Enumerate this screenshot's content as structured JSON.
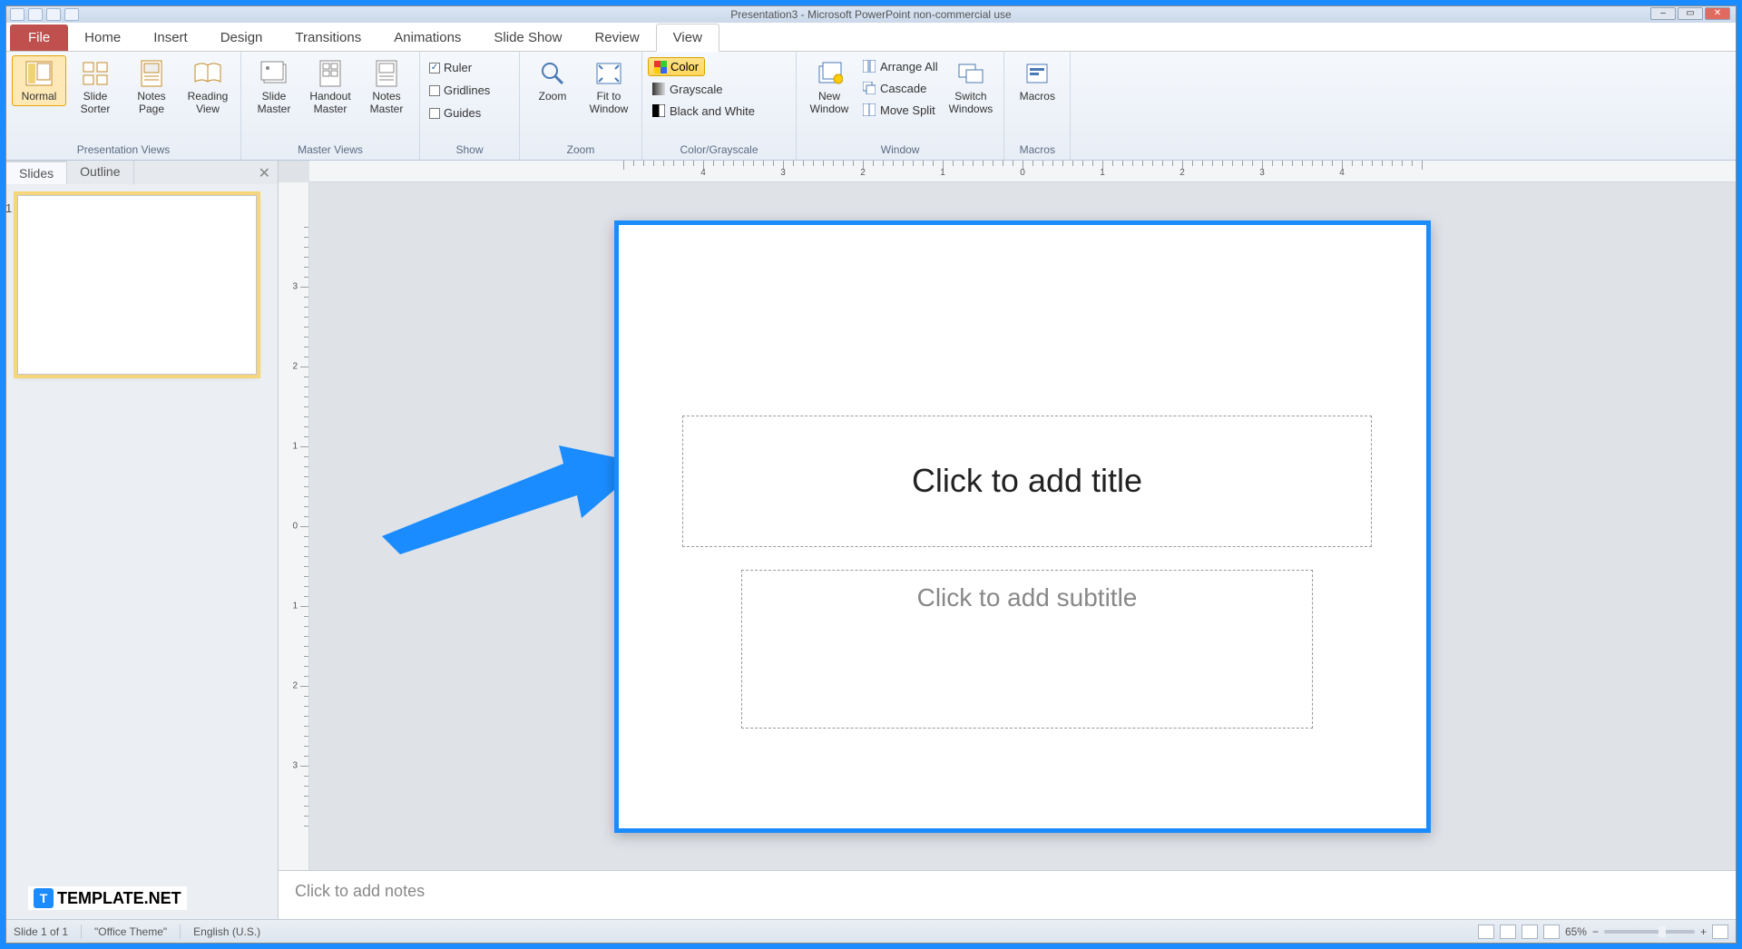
{
  "titlebar": {
    "title": "Presentation3 - Microsoft PowerPoint non-commercial use"
  },
  "tabs": {
    "file": "File",
    "items": [
      "Home",
      "Insert",
      "Design",
      "Transitions",
      "Animations",
      "Slide Show",
      "Review",
      "View"
    ],
    "active": "View"
  },
  "ribbon": {
    "presentation_views": {
      "title": "Presentation Views",
      "normal": "Normal",
      "slide_sorter": "Slide\nSorter",
      "notes_page": "Notes\nPage",
      "reading_view": "Reading\nView"
    },
    "master_views": {
      "title": "Master Views",
      "slide_master": "Slide\nMaster",
      "handout_master": "Handout\nMaster",
      "notes_master": "Notes\nMaster"
    },
    "show": {
      "title": "Show",
      "ruler": "Ruler",
      "gridlines": "Gridlines",
      "guides": "Guides"
    },
    "zoom": {
      "title": "Zoom",
      "zoom": "Zoom",
      "fit": "Fit to\nWindow"
    },
    "color": {
      "title": "Color/Grayscale",
      "color": "Color",
      "grayscale": "Grayscale",
      "bw": "Black and White"
    },
    "window": {
      "title": "Window",
      "new_window": "New\nWindow",
      "arrange_all": "Arrange All",
      "cascade": "Cascade",
      "move_split": "Move Split",
      "switch": "Switch\nWindows"
    },
    "macros": {
      "title": "Macros",
      "macros": "Macros"
    }
  },
  "leftpane": {
    "slides_tab": "Slides",
    "outline_tab": "Outline",
    "slide_number": "1"
  },
  "slide": {
    "title_placeholder": "Click to add title",
    "subtitle_placeholder": "Click to add subtitle"
  },
  "notes": {
    "placeholder": "Click to add notes"
  },
  "status": {
    "slide_pos": "Slide 1 of 1",
    "theme": "\"Office Theme\"",
    "lang": "English (U.S.)",
    "zoom": "65%"
  },
  "ruler": {
    "h": [
      "4",
      "3",
      "2",
      "1",
      "0",
      "1",
      "2",
      "3",
      "4"
    ],
    "v": [
      "3",
      "2",
      "1",
      "0",
      "1",
      "2",
      "3"
    ]
  },
  "watermark": {
    "text": "TEMPLATE.NET"
  }
}
